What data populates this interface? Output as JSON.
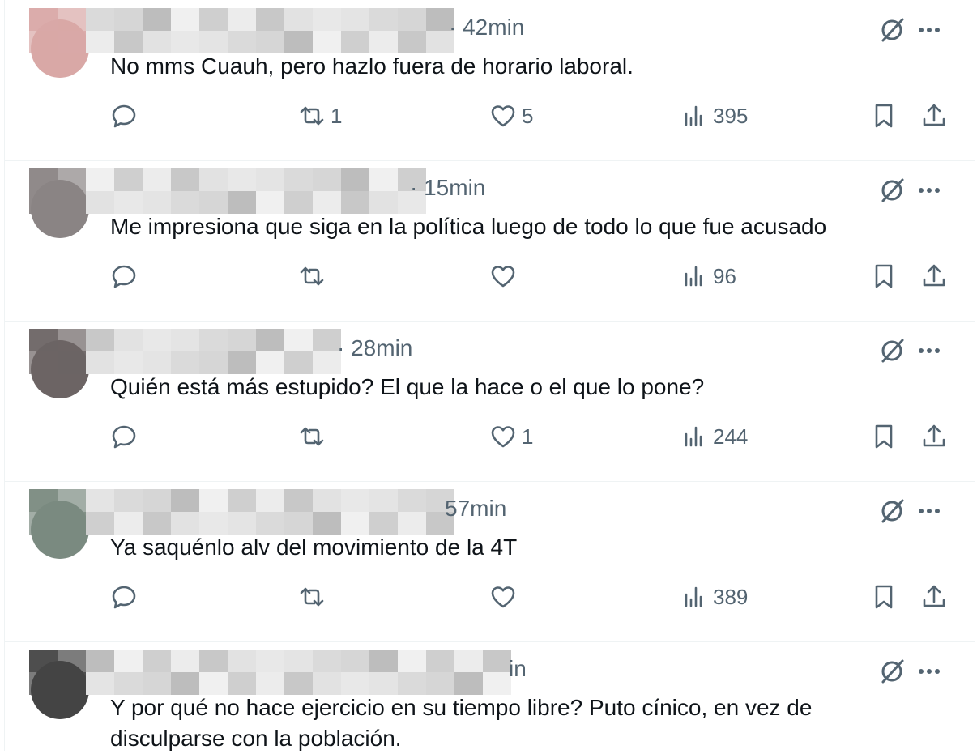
{
  "replies": [
    {
      "time": "· 42min",
      "text": "No mms Cuauh, pero hazlo fuera de horario laboral.",
      "reply_count": "",
      "retweets": "1",
      "likes": "5",
      "views": "395",
      "avatar_color": "#d9a8a6"
    },
    {
      "time": "· 15min",
      "text": "Me impresiona que siga en la política luego de todo lo que fue acusado",
      "reply_count": "",
      "retweets": "",
      "likes": "",
      "views": "96",
      "avatar_color": "#8a8484"
    },
    {
      "time": "· 28min",
      "text": "Quién está más estupido? El que la hace o el que lo pone?",
      "reply_count": "",
      "retweets": "",
      "likes": "1",
      "views": "244",
      "avatar_color": "#6c6464"
    },
    {
      "time": "57min",
      "text": "Ya saquénlo alv del movimiento de la 4T",
      "reply_count": "",
      "retweets": "",
      "likes": "",
      "views": "389",
      "avatar_color": "#7a8a80"
    },
    {
      "time": "in",
      "text": "Y por qué no hace ejercicio en su tiempo libre? Puto cínico, en vez de disculparse con la población.",
      "reply_count": "",
      "retweets": "",
      "likes": "",
      "views": "",
      "avatar_color": "#444444"
    }
  ],
  "colors": {
    "text": "#0f1419",
    "muted": "#536471",
    "border": "#eff3f4"
  },
  "icons": [
    "reply-icon",
    "retweet-icon",
    "like-icon",
    "views-icon",
    "bookmark-icon",
    "share-icon",
    "grok-icon",
    "more-icon"
  ]
}
